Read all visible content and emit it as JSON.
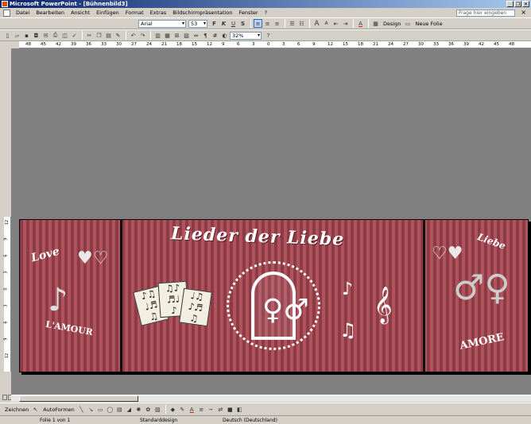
{
  "window": {
    "title": "Microsoft PowerPoint - [Bühnenbild3]",
    "controls": [
      "_",
      "❐",
      "✕"
    ]
  },
  "menu": {
    "items": [
      "Datei",
      "Bearbeiten",
      "Ansicht",
      "Einfügen",
      "Format",
      "Extras",
      "Bildschirmpräsentation",
      "Fenster",
      "?"
    ],
    "help_placeholder": "Frage hier eingeben"
  },
  "format_toolbar": {
    "font": "Arial",
    "size": "53",
    "bold": "F",
    "italic": "K",
    "underline": "U",
    "shadow": "S",
    "design_label": "Design",
    "new_slide_label": "Neue Folie"
  },
  "standard_toolbar": {
    "zoom": "32%"
  },
  "ruler": {
    "h_ticks": [
      "48",
      "45",
      "42",
      "39",
      "36",
      "33",
      "30",
      "27",
      "24",
      "21",
      "18",
      "15",
      "12",
      "9",
      "6",
      "3",
      "0",
      "3",
      "6",
      "9",
      "12",
      "15",
      "18",
      "21",
      "24",
      "27",
      "30",
      "33",
      "36",
      "39",
      "42",
      "45",
      "48"
    ],
    "v_ticks": [
      "12",
      "9",
      "6",
      "3",
      "0",
      "3",
      "6",
      "9",
      "12"
    ]
  },
  "slide": {
    "title": "Lieder der Liebe",
    "love": "Love",
    "lamour": "L'AMOUR",
    "liebe": "Liebe",
    "amore": "AMORE"
  },
  "drawbar": {
    "draw_label": "Zeichnen",
    "autoshapes_label": "AutoFormen"
  },
  "status": {
    "slide": "Folie 1 von 1",
    "design": "Standarddesign",
    "language": "Deutsch (Deutschland)"
  },
  "colors": {
    "stripe_dark": "#8a3b46",
    "stripe_light": "#b1525c",
    "workspace": "#808080"
  }
}
